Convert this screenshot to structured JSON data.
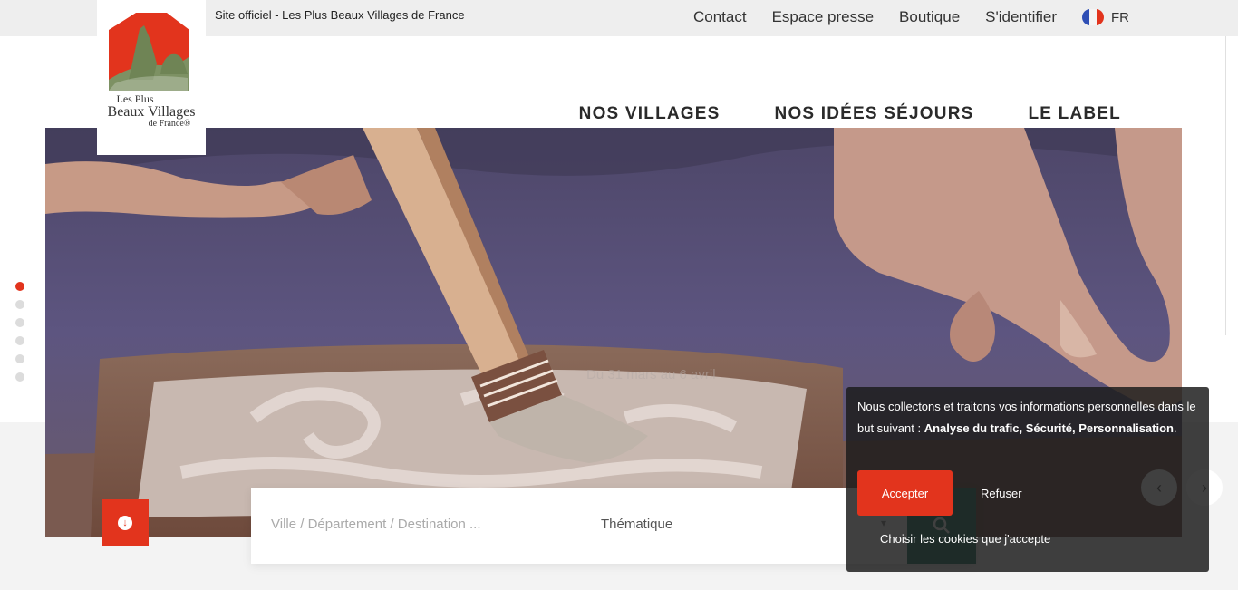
{
  "topbar": {
    "tagline": "Site officiel - Les Plus Beaux Villages de France",
    "links": [
      "Contact",
      "Espace presse",
      "Boutique",
      "S'identifier"
    ],
    "language": "FR"
  },
  "logo": {
    "line1": "Les Plus",
    "line2": "Beaux Villages",
    "line3": "de France®"
  },
  "nav": {
    "items": [
      "NOS VILLAGES",
      "NOS IDÉES SÉJOURS",
      "LE LABEL"
    ]
  },
  "hero": {
    "caption": "Du 31 mars au 6 avril",
    "slides_total": 6,
    "active_slide": 1
  },
  "search": {
    "destination_placeholder": "Ville / Département / Destination ...",
    "theme_label": "Thématique"
  },
  "slider": {
    "prev_icon": "‹",
    "next_icon": "›"
  },
  "cookie": {
    "text_intro": "Nous collectons et traitons vos informations personnelles dans le but suivant : ",
    "text_purposes": "Analyse du trafic, Sécurité, Personnalisation",
    "text_end": ".",
    "accept_label": "Accepter",
    "refuse_label": "Refuser",
    "choose_label": "Choisir les cookies que j'accepte"
  },
  "colors": {
    "accent": "#e2341d",
    "search_button": "#2f7a6a",
    "topbar": "#eeeeee"
  }
}
